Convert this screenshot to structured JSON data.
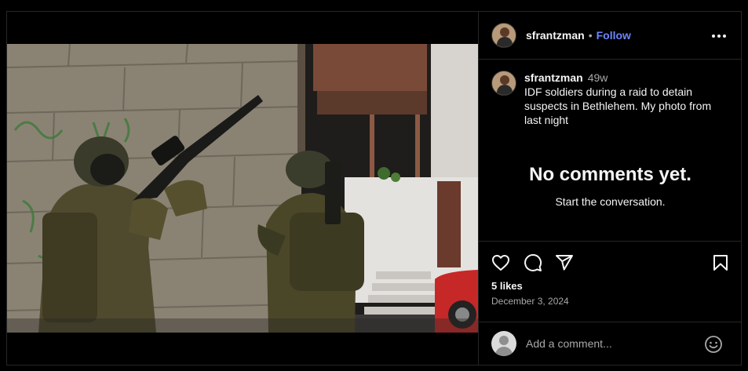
{
  "post": {
    "username": "sfrantzman",
    "follow_label": "Follow",
    "separator": "•",
    "time_ago": "49w",
    "caption": "IDF soldiers during a raid to detain suspects in Bethlehem. My photo from last night",
    "likes": "5 likes",
    "date": "December 3, 2024"
  },
  "comments": {
    "empty_title": "No comments yet.",
    "empty_subtitle": "Start the conversation.",
    "input_placeholder": "Add a comment..."
  },
  "icons": {
    "more": "more-options-icon",
    "like": "heart-icon",
    "comment": "comment-icon",
    "share": "send-icon",
    "save": "bookmark-icon",
    "emoji": "emoji-icon"
  },
  "colors": {
    "background": "#000000",
    "follow": "#6b86ff",
    "secondary_text": "#a8a8a8",
    "divider": "#262626"
  }
}
